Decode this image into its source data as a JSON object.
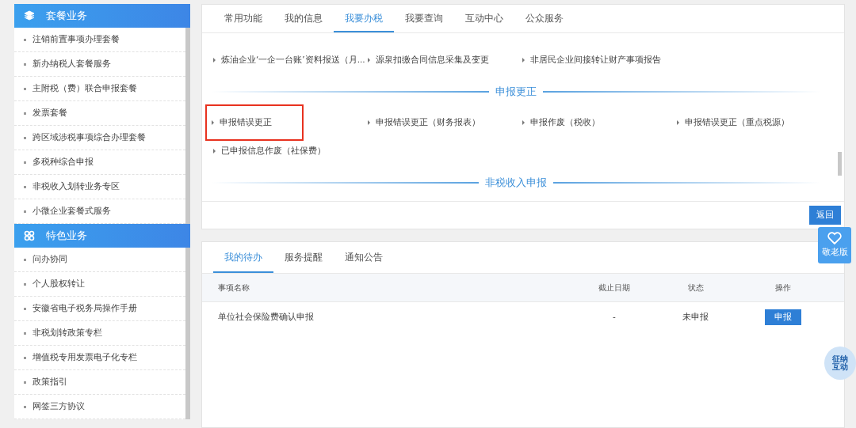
{
  "sidebar": [
    {
      "title": "套餐业务",
      "items": [
        "注销前置事项办理套餐",
        "新办纳税人套餐服务",
        "主附税（费）联合申报套餐",
        "发票套餐",
        "跨区域涉税事项综合办理套餐",
        "多税种综合申报",
        "非税收入划转业务专区",
        "小微企业套餐式服务"
      ]
    },
    {
      "title": "特色业务",
      "items": [
        "问办协同",
        "个人股权转让",
        "安徽省电子税务局操作手册",
        "非税划转政策专栏",
        "增值税专用发票电子化专栏",
        "政策指引",
        "网签三方协议"
      ]
    }
  ],
  "tabs": [
    {
      "label": "常用功能",
      "selected": false
    },
    {
      "label": "我的信息",
      "selected": false
    },
    {
      "label": "我要办税",
      "selected": true
    },
    {
      "label": "我要查询",
      "selected": false
    },
    {
      "label": "互动中心",
      "selected": false
    },
    {
      "label": "公众服务",
      "selected": false
    }
  ],
  "sections": [
    {
      "links": [
        {
          "label": "炼油企业‘一企一台账’资料报送（月...",
          "highlighted": false
        },
        {
          "label": "源泉扣缴合同信息采集及变更",
          "highlighted": false
        },
        {
          "label": "非居民企业间接转让财产事项报告",
          "highlighted": false
        }
      ]
    },
    {
      "heading": "申报更正",
      "links": [
        {
          "label": "申报错误更正",
          "highlighted": true
        },
        {
          "label": "申报错误更正（财务报表）",
          "highlighted": false
        },
        {
          "label": "申报作废（税收）",
          "highlighted": false
        },
        {
          "label": "申报错误更正（重点税源）",
          "highlighted": false
        },
        {
          "label": "已申报信息作废（社保费）",
          "highlighted": false
        }
      ]
    },
    {
      "heading": "非税收入申报"
    }
  ],
  "back_button": "返回",
  "elder_button": "敬老版",
  "assistant_badge": "征纳互动",
  "todo": {
    "tabs": [
      {
        "label": "我的待办",
        "selected": true
      },
      {
        "label": "服务提醒",
        "selected": false
      },
      {
        "label": "通知公告",
        "selected": false
      }
    ],
    "columns": [
      "事项名称",
      "截止日期",
      "状态",
      "操作"
    ],
    "rows": [
      {
        "name": "单位社会保险费确认申报",
        "deadline": "-",
        "status": "未申报",
        "action": "申报"
      }
    ]
  }
}
